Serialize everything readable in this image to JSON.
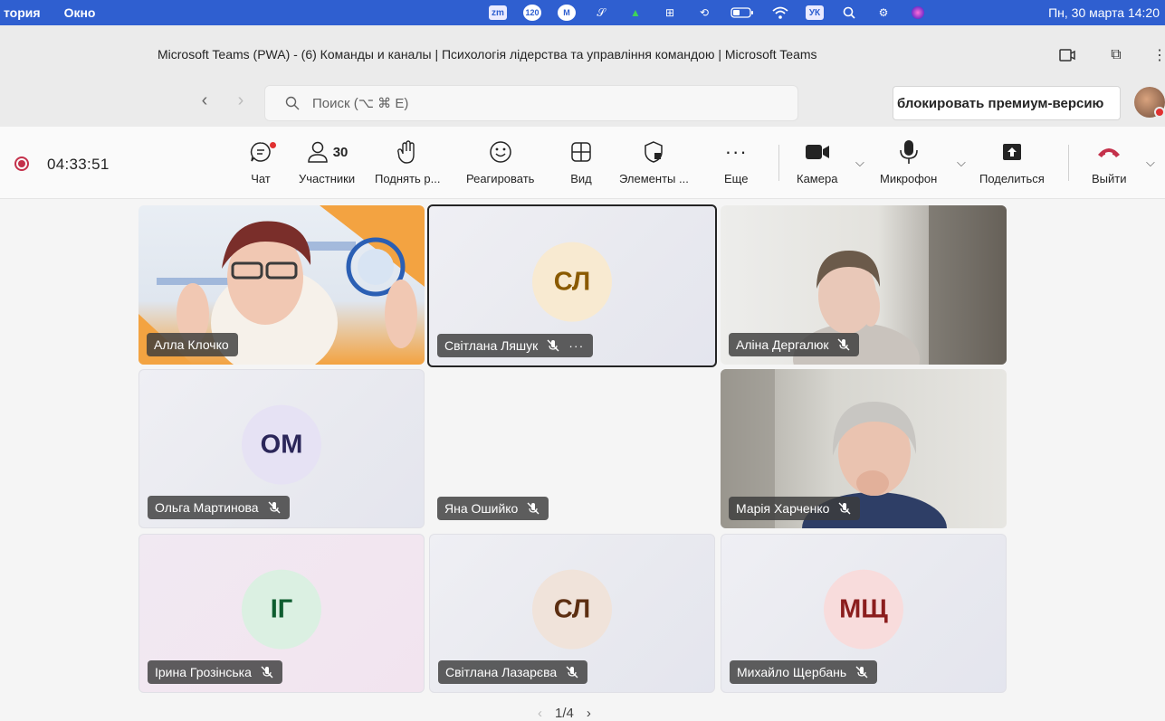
{
  "menubar": {
    "items": [
      "тория",
      "Окно"
    ],
    "icons": [
      "zm",
      "120",
      "M",
      "script-icon",
      "fire-icon",
      "grid-icon",
      "history-icon",
      "battery-icon",
      "wifi-icon",
      "УК",
      "search-icon",
      "control-icon",
      "siri-icon"
    ],
    "clock": "Пн, 30 марта 14:20"
  },
  "window": {
    "title": "Microsoft Teams (PWA) - (6) Команды и каналы | Психологія лідерства та управління командою | Microsoft Teams"
  },
  "search": {
    "placeholder": "Поиск (⌥ ⌘ E)"
  },
  "premium_label": "блокировать премиум-версию",
  "call": {
    "timer": "04:33:51",
    "participants_count": "30",
    "tools": [
      {
        "id": "chat",
        "label": "Чат"
      },
      {
        "id": "participants",
        "label": "Участники"
      },
      {
        "id": "raise",
        "label": "Поднять р..."
      },
      {
        "id": "react",
        "label": "Реагировать"
      },
      {
        "id": "view",
        "label": "Вид"
      },
      {
        "id": "apps",
        "label": "Элементы ..."
      },
      {
        "id": "more",
        "label": "Еще"
      },
      {
        "id": "camera",
        "label": "Камера"
      },
      {
        "id": "mic",
        "label": "Микрофон"
      },
      {
        "id": "share",
        "label": "Поделиться"
      },
      {
        "id": "leave",
        "label": "Выйти"
      }
    ]
  },
  "participants": [
    {
      "name": "Алла Клочко",
      "initials": "",
      "type": "video"
    },
    {
      "name": "Світлана Ляшук",
      "initials": "СЛ",
      "type": "avatar",
      "avatar_color": "#f8ead1",
      "text_color": "#8a5a00"
    },
    {
      "name": "Аліна Дергалюк",
      "initials": "",
      "type": "video"
    },
    {
      "name": "Ольга Мартинова",
      "initials": "ОМ",
      "type": "avatar",
      "avatar_color": "#e6e2f4",
      "text_color": "#2b2659"
    },
    {
      "name": "Яна Ошийко",
      "initials": "",
      "type": "empty"
    },
    {
      "name": "Марія Харченко",
      "initials": "",
      "type": "video"
    },
    {
      "name": "Ірина Грозінська",
      "initials": "ІГ",
      "type": "avatar",
      "avatar_color": "#dbf0e2",
      "text_color": "#0e5c2f"
    },
    {
      "name": "Світлана Лазарєва",
      "initials": "СЛ",
      "type": "avatar",
      "avatar_color": "#f0e3da",
      "text_color": "#5c2e11"
    },
    {
      "name": "Михайло Щербань",
      "initials": "МЩ",
      "type": "avatar",
      "avatar_color": "#f8dcdc",
      "text_color": "#8b1d1d"
    }
  ],
  "pager": "1/4",
  "colors": {
    "accent": "#5b5fc7",
    "leave": "#c4314b",
    "record": "#c4314b"
  }
}
